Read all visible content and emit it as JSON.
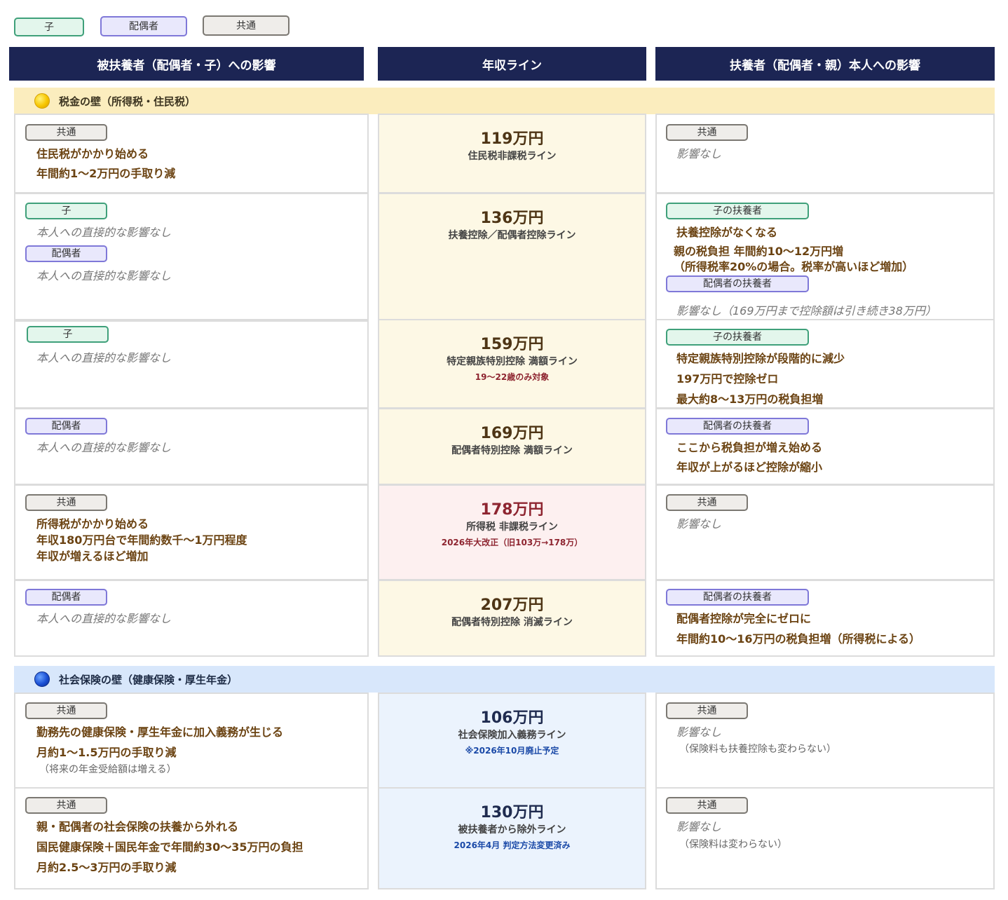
{
  "legend": {
    "child": "子",
    "spouse": "配偶者",
    "common": "共通"
  },
  "headers": {
    "left": "被扶養者（配偶者・子）への影響",
    "middle": "年収ライン",
    "right": "扶養者（配偶者・親）本人への影響"
  },
  "sections": {
    "tax": {
      "title": "税金の壁（所得税・住民税）"
    },
    "social": {
      "title": "社会保険の壁（健康保険・厚生年金）"
    }
  },
  "rows": {
    "r119": {
      "left": {
        "tag": "共通",
        "lines": [
          "住民税がかかり始める",
          "年間約1～2万円の手取り減"
        ]
      },
      "amount": "119万円",
      "sub": "住民税非課税ライン",
      "right": {
        "tag": "共通",
        "text": "影響なし"
      }
    },
    "r136": {
      "left": {
        "tag1": "子",
        "text1": "本人への直接的な影響なし",
        "tag2": "配偶者",
        "text2": "本人への直接的な影響なし"
      },
      "amount": "136万円",
      "sub": "扶養控除／配偶者控除ライン",
      "right": {
        "tag1": "子の扶養者",
        "lines": [
          "扶養控除がなくなる",
          "親の税負担 年間約10～12万円増",
          "（所得税率20%の場合。税率が高いほど増加）"
        ],
        "tag2": "配偶者の扶養者",
        "text2": "影響なし（169万円まで控除額は引き続き38万円）"
      }
    },
    "r159": {
      "left": {
        "tag": "子",
        "text": "本人への直接的な影響なし"
      },
      "amount": "159万円",
      "sub": "特定親族特別控除 満額ライン",
      "note": "19～22歳のみ対象",
      "right": {
        "tag": "子の扶養者",
        "lines": [
          "特定親族特別控除が段階的に減少",
          "197万円で控除ゼロ",
          "最大約8～13万円の税負担増"
        ]
      }
    },
    "r169": {
      "left": {
        "tag": "配偶者",
        "text": "本人への直接的な影響なし"
      },
      "amount": "169万円",
      "sub": "配偶者特別控除 満額ライン",
      "right": {
        "tag": "配偶者の扶養者",
        "lines": [
          "ここから税負担が増え始める",
          "年収が上がるほど控除が縮小"
        ]
      }
    },
    "r178": {
      "left": {
        "tag": "共通",
        "lines": [
          "所得税がかかり始める",
          "年収180万円台で年間約数千～1万円程度",
          "年収が増えるほど増加"
        ]
      },
      "amount": "178万円",
      "sub": "所得税 非課税ライン",
      "note": "2026年大改正（旧103万→178万）",
      "right": {
        "tag": "共通",
        "text": "影響なし"
      }
    },
    "r207": {
      "left": {
        "tag": "配偶者",
        "text": "本人への直接的な影響なし"
      },
      "amount": "207万円",
      "sub": "配偶者特別控除 消滅ライン",
      "right": {
        "tag": "配偶者の扶養者",
        "lines": [
          "配偶者控除が完全にゼロに",
          "年間約10～16万円の税負担増（所得税による）"
        ]
      }
    },
    "r106": {
      "left": {
        "tag": "共通",
        "lines": [
          "勤務先の健康保険・厚生年金に加入義務が生じる",
          "月約1～1.5万円の手取り減"
        ],
        "small": "（将来の年金受給額は増える）"
      },
      "amount": "106万円",
      "sub": "社会保険加入義務ライン",
      "note": "※2026年10月廃止予定",
      "right": {
        "tag": "共通",
        "text": "影響なし",
        "small": "（保険料も扶養控除も変わらない）"
      }
    },
    "r130": {
      "left": {
        "tag": "共通",
        "lines": [
          "親・配偶者の社会保険の扶養から外れる",
          "国民健康保険＋国民年金で年間約30～35万円の負担",
          "月約2.5～3万円の手取り減"
        ]
      },
      "amount": "130万円",
      "sub": "被扶養者から除外ライン",
      "note": "2026年4月 判定方法変更済み",
      "right": {
        "tag": "共通",
        "text": "影響なし",
        "small": "（保険料は変わらない）"
      }
    }
  },
  "colors": {
    "header_bg": "#1c2554",
    "tax_band": "#fbedbe",
    "social_band": "#d8e7fb",
    "amount_brown": "#4e3515",
    "amount_red": "#8e2530",
    "note_blue": "#1b4aa8"
  }
}
